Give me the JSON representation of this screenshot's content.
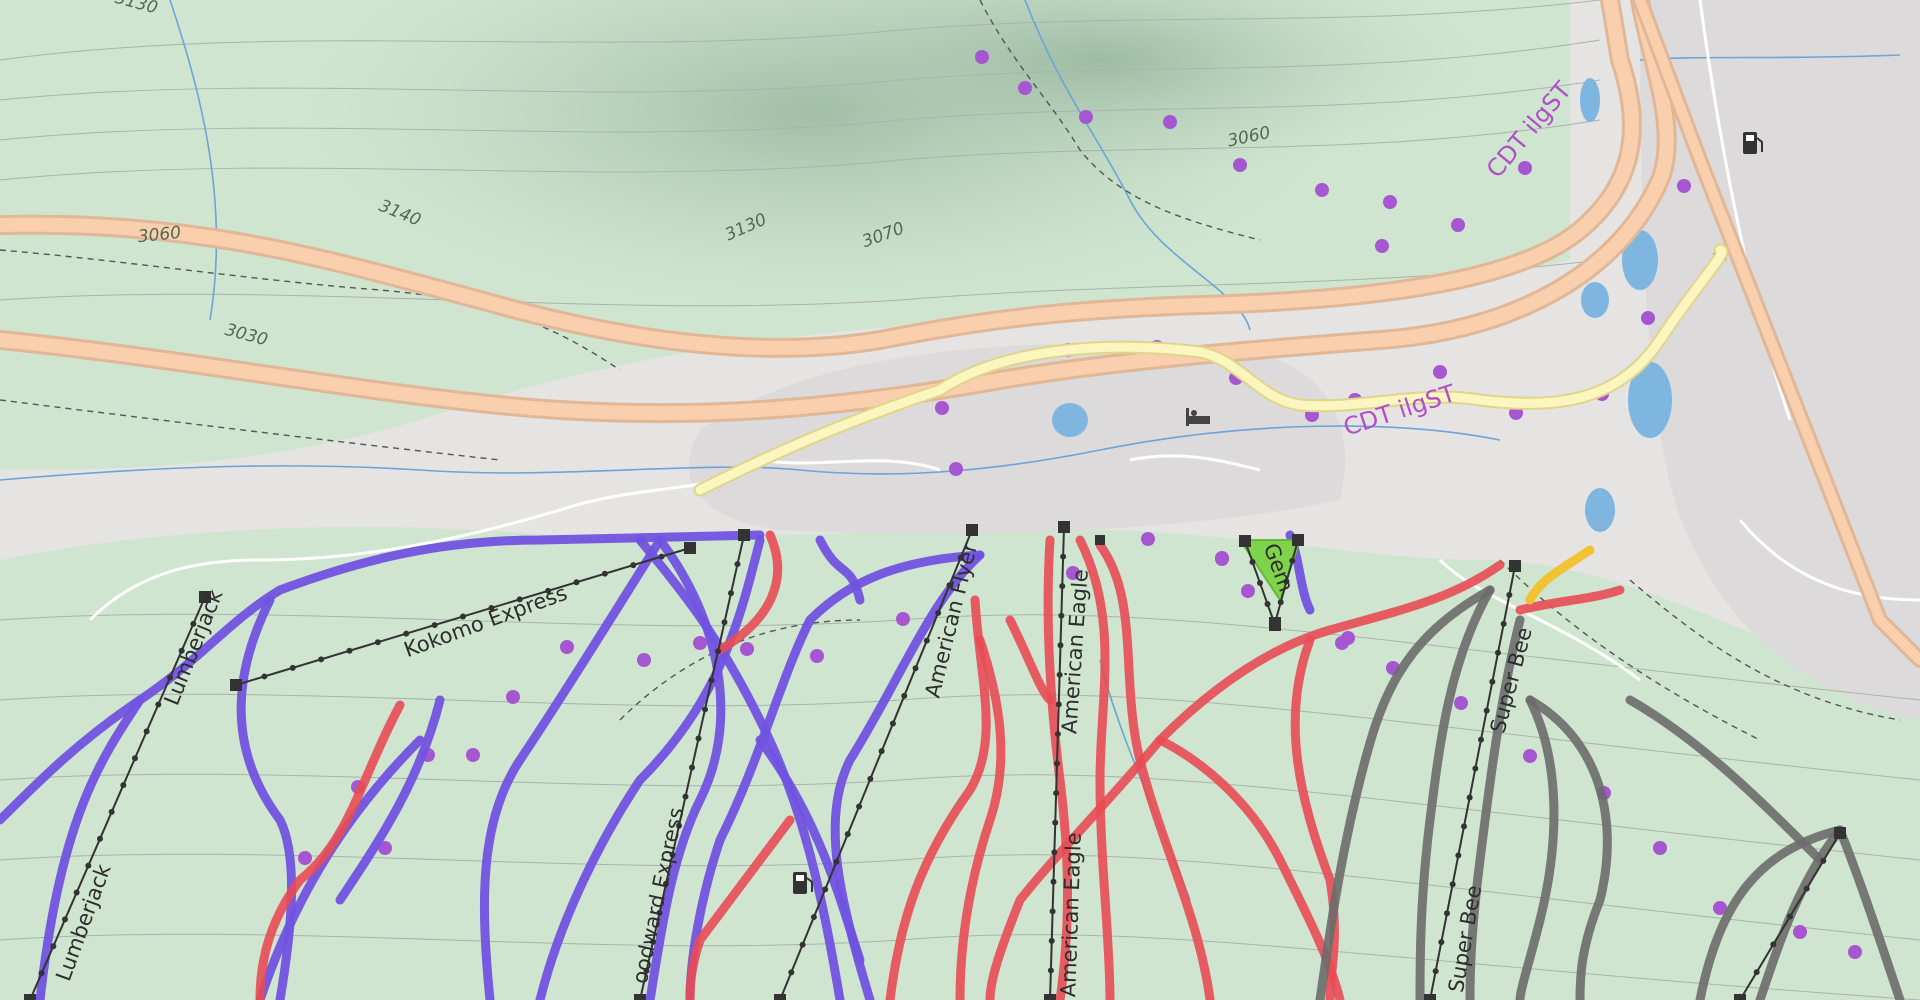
{
  "map": {
    "contour_labels": [
      "3140",
      "3130",
      "3070",
      "3060",
      "3060",
      "3030",
      "3130"
    ],
    "route_labels": [
      "CDT ilgST",
      "CDT ilgST"
    ],
    "lift_labels": [
      "Kokomo Express",
      "Lumberjack",
      "Lumberjack",
      "American Flyer",
      "American Eagle",
      "American Eagle",
      "Gem",
      "Super Bee",
      "Super Bee",
      "oodward Express"
    ],
    "icons": [
      "fuel-icon",
      "fuel-icon",
      "lodging-icon",
      "lift-station-icon"
    ],
    "colors": {
      "background": "#e6e4e3",
      "forest": "#cfe5cf",
      "highway_casing": "#e0b898",
      "highway_fill": "#f9cfae",
      "primary_road_casing": "#e0d58b",
      "primary_road_fill": "#fbf5c0",
      "piste_easy_blue": "#7153e0",
      "piste_intermediate_red": "#e84b54",
      "piste_advanced_black": "#6b6b6b",
      "piste_novice_green": "#7fd34a",
      "piste_yellow": "#f1c232",
      "trail_dots": "#a656d0",
      "water": "#7fb6e0",
      "lift_line": "#333333"
    }
  }
}
